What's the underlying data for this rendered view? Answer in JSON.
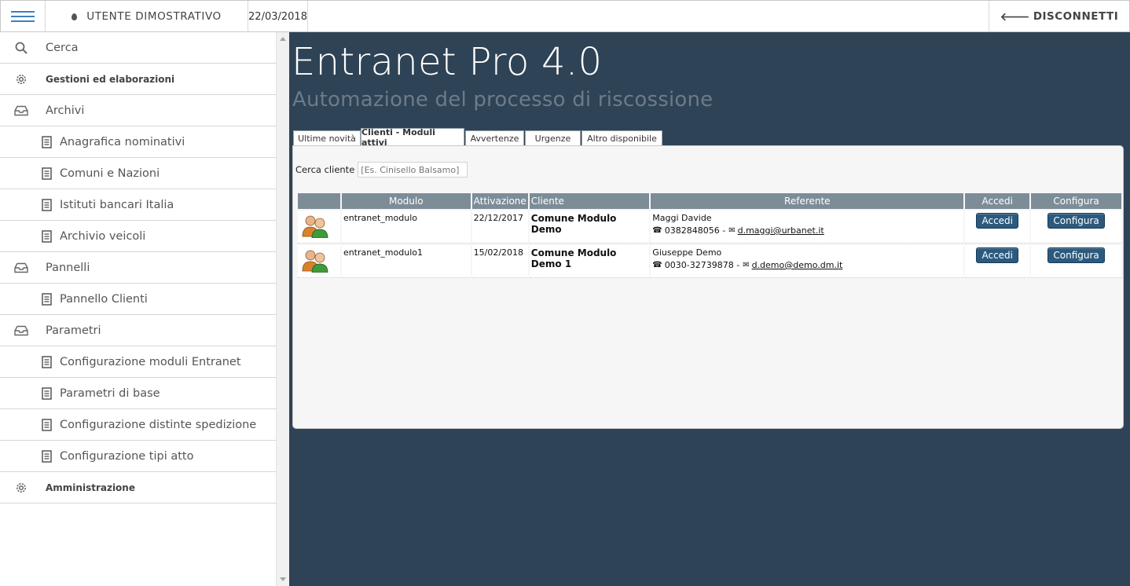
{
  "header": {
    "user": "UTENTE DIMOSTRATIVO",
    "date": "22/03/2018",
    "logout": "DISCONNETTI"
  },
  "sidebar": {
    "items": [
      {
        "label": "Cerca",
        "icon": "search-icon",
        "level": 0,
        "bold": false
      },
      {
        "label": "Gestioni ed elaborazioni",
        "icon": "gear-icon",
        "level": 0,
        "bold": true
      },
      {
        "label": "Archivi",
        "icon": "inbox-icon",
        "level": 0,
        "bold": false
      },
      {
        "label": "Anagrafica nominativi",
        "icon": "document-icon",
        "level": 1,
        "bold": false
      },
      {
        "label": "Comuni e Nazioni",
        "icon": "document-icon",
        "level": 1,
        "bold": false
      },
      {
        "label": "Istituti bancari Italia",
        "icon": "document-icon",
        "level": 1,
        "bold": false
      },
      {
        "label": "Archivio veicoli",
        "icon": "document-icon",
        "level": 1,
        "bold": false
      },
      {
        "label": "Pannelli",
        "icon": "inbox-icon",
        "level": 0,
        "bold": false
      },
      {
        "label": "Pannello Clienti",
        "icon": "document-icon",
        "level": 1,
        "bold": false
      },
      {
        "label": "Parametri",
        "icon": "inbox-icon",
        "level": 0,
        "bold": false
      },
      {
        "label": "Configurazione moduli Entranet",
        "icon": "document-icon",
        "level": 1,
        "bold": false
      },
      {
        "label": "Parametri di base",
        "icon": "document-icon",
        "level": 1,
        "bold": false
      },
      {
        "label": "Configurazione distinte spedizione",
        "icon": "document-icon",
        "level": 1,
        "bold": false
      },
      {
        "label": "Configurazione tipi atto",
        "icon": "document-icon",
        "level": 1,
        "bold": false
      },
      {
        "label": "Amministrazione",
        "icon": "gear-icon",
        "level": 0,
        "bold": true
      }
    ]
  },
  "main": {
    "title": "Entranet Pro 4.0",
    "subtitle": "Automazione del processo di riscossione",
    "tabs": [
      {
        "label": "Ultime novità",
        "active": false
      },
      {
        "label": "Clienti - Moduli attivi",
        "active": true
      },
      {
        "label": "Avvertenze",
        "active": false
      },
      {
        "label": "Urgenze",
        "active": false
      },
      {
        "label": "Altro disponibile",
        "active": false
      }
    ],
    "search": {
      "label": "Cerca cliente",
      "placeholder": "[Es. Cinisello Balsamo]"
    },
    "table": {
      "headers": [
        "",
        "Modulo",
        "Attivazione",
        "Cliente",
        "Referente",
        "Accedi",
        "Configura"
      ],
      "rows": [
        {
          "modulo": "entranet_modulo",
          "attivazione": "22/12/2017",
          "cliente": "Comune Modulo Demo",
          "referente": "Maggi Davide",
          "telefono": "0382848056 -",
          "email": "d.maggi@urbanet.it",
          "accedi": "Accedi",
          "configura": "Configura"
        },
        {
          "modulo": "entranet_modulo1",
          "attivazione": "15/02/2018",
          "cliente": "Comune Modulo Demo 1",
          "referente": "Giuseppe Demo",
          "telefono": "0030-32739878 -",
          "email": "d.demo@demo.dm.it",
          "accedi": "Accedi",
          "configura": "Configura"
        }
      ]
    }
  },
  "colors": {
    "main_bg": "#2f4356",
    "header_cell": "#7c8d98",
    "button": "#2c5a7e",
    "menu_icon": "#3f7fbf"
  }
}
